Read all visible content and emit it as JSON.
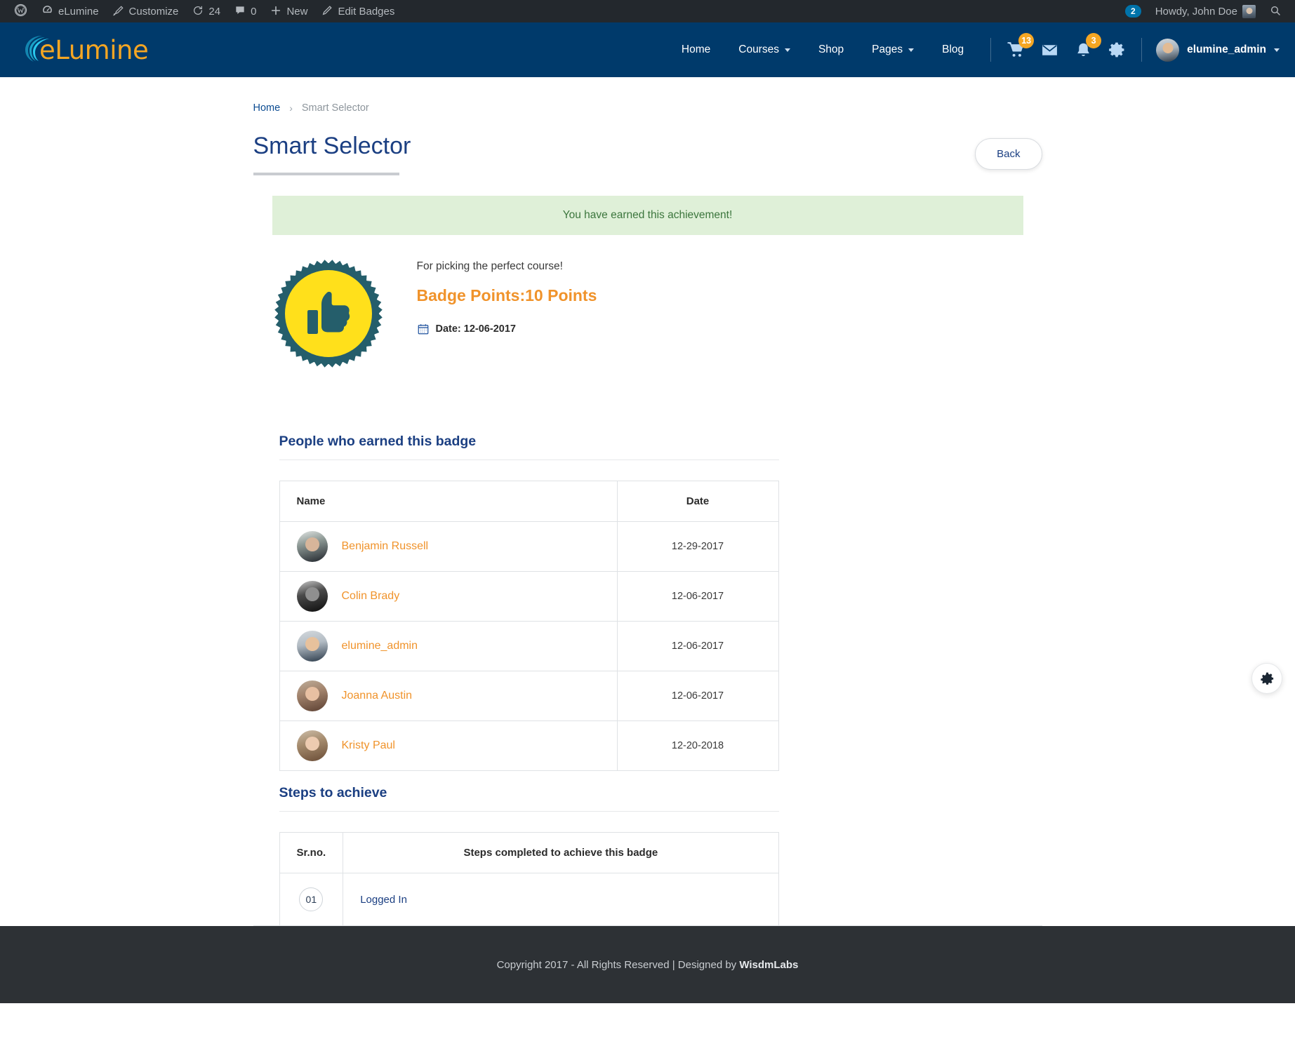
{
  "adminbar": {
    "items": [
      {
        "name": "wp-logo",
        "icon": "wordpress-icon",
        "label": ""
      },
      {
        "name": "site-name",
        "icon": "dashboard-icon",
        "label": "eLumine"
      },
      {
        "name": "customize",
        "icon": "brush-icon",
        "label": "Customize"
      },
      {
        "name": "updates",
        "icon": "update-icon",
        "label": "24"
      },
      {
        "name": "comments",
        "icon": "comment-icon",
        "label": "0"
      },
      {
        "name": "new-content",
        "icon": "plus-icon",
        "label": "New"
      },
      {
        "name": "edit-badges",
        "icon": "pencil-icon",
        "label": "Edit Badges"
      }
    ],
    "notification_count": "2",
    "howdy": "Howdy, John Doe",
    "search_icon": "search-icon"
  },
  "header": {
    "logo_text": "eLumine",
    "nav": [
      {
        "label": "Home",
        "has_caret": false
      },
      {
        "label": "Courses",
        "has_caret": true
      },
      {
        "label": "Shop",
        "has_caret": false
      },
      {
        "label": "Pages",
        "has_caret": true
      },
      {
        "label": "Blog",
        "has_caret": false
      }
    ],
    "cart_count": "13",
    "notification_count": "3",
    "user_name": "elumine_admin"
  },
  "breadcrumb": {
    "home": "Home",
    "separator": "›",
    "current": "Smart Selector"
  },
  "page": {
    "title": "Smart Selector",
    "back_label": "Back"
  },
  "alert": {
    "message": "You have earned this achievement!"
  },
  "badge": {
    "description": "For picking the perfect course!",
    "points_label": "Badge Points:",
    "points_value": "10 Points",
    "date_label": "Date: 12-06-2017",
    "image_alt": "thumbs-up-badge"
  },
  "people_section": {
    "heading": "People who earned this badge",
    "columns": [
      "Name",
      "Date"
    ],
    "rows": [
      {
        "name": "Benjamin Russell",
        "date": "12-29-2017",
        "avatar": "a1"
      },
      {
        "name": "Colin Brady",
        "date": "12-06-2017",
        "avatar": "a2"
      },
      {
        "name": "elumine_admin",
        "date": "12-06-2017",
        "avatar": "a3"
      },
      {
        "name": "Joanna Austin",
        "date": "12-06-2017",
        "avatar": "a4"
      },
      {
        "name": "Kristy Paul",
        "date": "12-20-2018",
        "avatar": "a5"
      }
    ]
  },
  "steps_section": {
    "heading": "Steps to achieve",
    "columns": [
      "Sr.no.",
      "Steps completed to achieve this badge"
    ],
    "rows": [
      {
        "srno": "01",
        "step": "Logged In"
      }
    ]
  },
  "float_button": {
    "icon": "gear-icon"
  },
  "footer": {
    "text": "Copyright 2017 - All Rights Reserved | Designed by ",
    "brand": "WisdmLabs"
  },
  "colors": {
    "header_navy": "#003a6b",
    "accent_orange": "#f0932b",
    "link_blue": "#1b3f82",
    "alert_green_bg": "#dff0d8",
    "alert_green_text": "#3c763d",
    "footer_dark": "#2d3135",
    "adminbar_dark": "#23282d"
  }
}
